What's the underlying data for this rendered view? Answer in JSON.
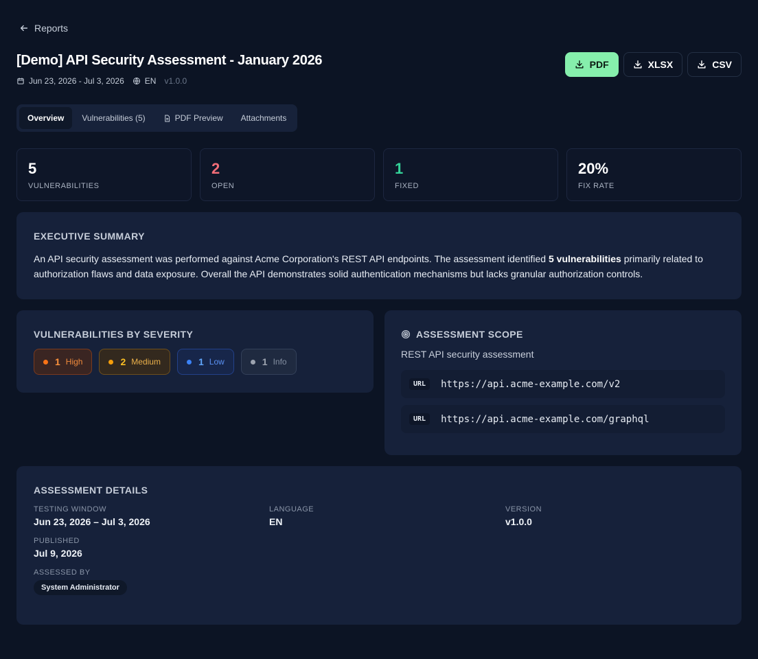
{
  "nav": {
    "back_label": "Reports"
  },
  "header": {
    "title": "[Demo] API Security Assessment - January 2026",
    "date_range": "Jun 23, 2026 - Jul 3, 2026",
    "language": "EN",
    "version": "v1.0.0"
  },
  "exports": {
    "pdf": "PDF",
    "xlsx": "XLSX",
    "csv": "CSV",
    "accent": "#86efac"
  },
  "tabs": [
    {
      "label": "Overview",
      "active": true
    },
    {
      "label": "Vulnerabilities (5)",
      "active": false
    },
    {
      "label": "PDF Preview",
      "active": false,
      "icon": "document-icon"
    },
    {
      "label": "Attachments",
      "active": false
    }
  ],
  "stats": [
    {
      "value": "5",
      "label": "VULNERABILITIES",
      "color": "#ffffff"
    },
    {
      "value": "2",
      "label": "OPEN",
      "color": "#f26d78"
    },
    {
      "value": "1",
      "label": "FIXED",
      "color": "#34d399"
    },
    {
      "value": "20%",
      "label": "FIX RATE",
      "color": "#ffffff"
    }
  ],
  "summary": {
    "title": "EXECUTIVE SUMMARY",
    "text_before": "An API security assessment was performed against Acme Corporation's REST API endpoints. The assessment identified ",
    "text_bold": "5 vulnerabilities",
    "text_after": " primarily related to authorization flaws and data exposure. Overall the API demonstrates solid authentication mechanisms but lacks granular authorization controls."
  },
  "severity": {
    "title": "VULNERABILITIES BY SEVERITY",
    "items": [
      {
        "count": "1",
        "label": "High"
      },
      {
        "count": "2",
        "label": "Medium"
      },
      {
        "count": "1",
        "label": "Low"
      },
      {
        "count": "1",
        "label": "Info"
      }
    ]
  },
  "scope": {
    "title": "ASSESSMENT SCOPE",
    "description": "REST API security assessment",
    "urls": [
      {
        "badge": "URL",
        "value": "https://api.acme-example.com/v2"
      },
      {
        "badge": "URL",
        "value": "https://api.acme-example.com/graphql"
      }
    ]
  },
  "details": {
    "title": "ASSESSMENT DETAILS",
    "testing_window_label": "TESTING WINDOW",
    "testing_window": "Jun 23, 2026 – Jul 3, 2026",
    "language_label": "LANGUAGE",
    "language": "EN",
    "version_label": "VERSION",
    "version": "v1.0.0",
    "published_label": "PUBLISHED",
    "published": "Jul 9, 2026",
    "assessed_by_label": "ASSESSED BY",
    "assessed_by": "System Administrator"
  }
}
